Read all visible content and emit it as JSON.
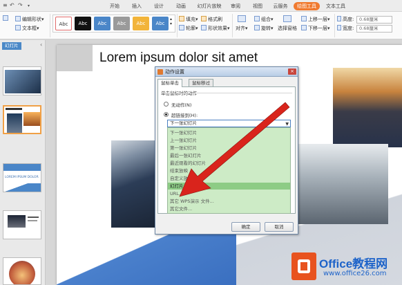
{
  "menubar": {
    "items": [
      "开始",
      "插入",
      "设计",
      "动画",
      "幻灯片放映",
      "审阅",
      "视图",
      "云服务",
      "绘图工具",
      "文本工具"
    ],
    "active": "绘图工具",
    "accent": "#f07a2f"
  },
  "ribbon": {
    "edit_shape": "编辑形状",
    "text_box": "文本框",
    "styles": [
      {
        "label": "Abc",
        "bg": "#ffffff",
        "fg": "#333333"
      },
      {
        "label": "Abc",
        "bg": "#111111",
        "fg": "#ffffff"
      },
      {
        "label": "Abc",
        "bg": "#4a86c8",
        "fg": "#ffffff"
      },
      {
        "label": "Abc",
        "bg": "#9a9a9a",
        "fg": "#ffffff"
      },
      {
        "label": "Abc",
        "bg": "#f2b43a",
        "fg": "#ffffff"
      },
      {
        "label": "Abc",
        "bg": "#4a86c8",
        "fg": "#ffffff"
      }
    ],
    "fill": "填充",
    "format_painter": "格式刷",
    "outline": "轮廓",
    "shape_effects": "形状效果",
    "align": "对齐",
    "group": "组合",
    "rotate": "旋转",
    "selection_pane": "选择窗格",
    "bring_forward": "上移一层",
    "send_backward": "下移一层",
    "height_label": "高度:",
    "width_label": "宽度:",
    "height_value": "0.68厘米",
    "width_value": "0.68厘米"
  },
  "left_panel": {
    "tab": "幻灯片",
    "thumb3_text": "LOREM IPSUM DOLOR"
  },
  "slide": {
    "title": "Lorem ipsum dolor sit amet"
  },
  "dialog": {
    "title": "动作设置",
    "close": "×",
    "tabs": [
      "鼠标单击",
      "鼠标移过"
    ],
    "section_label": "单击鼠标时的动作",
    "no_action": "无动作(N)",
    "hyperlink_to": "超链接到(H):",
    "selected_value": "下一张幻灯片",
    "options": [
      "下一张幻灯片",
      "上一张幻灯片",
      "第一张幻灯片",
      "最后一张幻灯片",
      "最近观看的幻灯片",
      "结束放映",
      "自定义放...",
      "幻灯片...",
      "URL...",
      "其它 WPS演示 文件...",
      "其它文件..."
    ],
    "highlighted_option": "幻灯片...",
    "ok": "确定",
    "cancel": "取消"
  },
  "watermark": {
    "title": "Office教程网",
    "url": "www.office26.com"
  }
}
